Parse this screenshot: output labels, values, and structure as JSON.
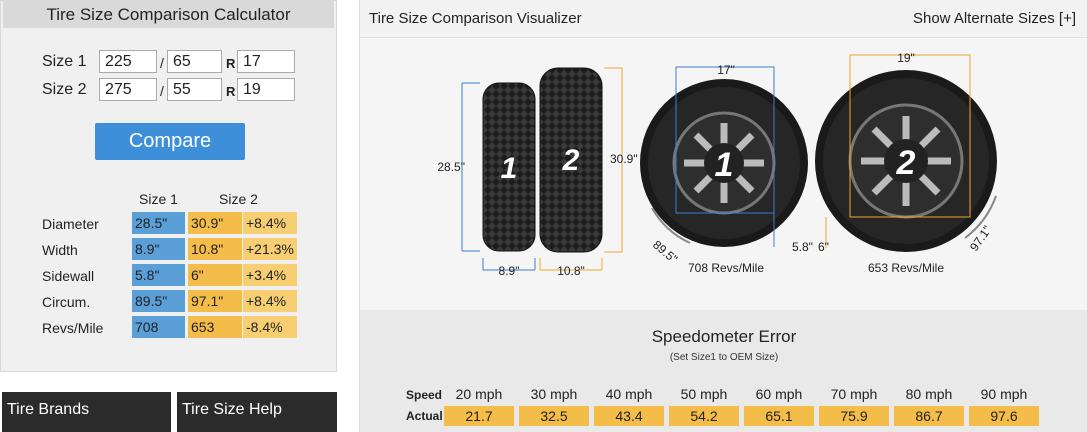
{
  "calculator": {
    "title": "Tire Size Comparison Calculator",
    "size1": {
      "label": "Size 1",
      "width": "225",
      "aspect": "65",
      "rim_prefix": "R",
      "rim": "17"
    },
    "size2": {
      "label": "Size 2",
      "width": "275",
      "aspect": "55",
      "rim_prefix": "R",
      "rim": "19"
    },
    "slash": "/",
    "compare_label": "Compare",
    "col_size1": "Size 1",
    "col_size2": "Size 2",
    "rows": [
      {
        "label": "Diameter",
        "s1": "28.5\"",
        "s2": "30.9\"",
        "diff": "+8.4%"
      },
      {
        "label": "Width",
        "s1": "8.9\"",
        "s2": "10.8\"",
        "diff": "+21.3%"
      },
      {
        "label": "Sidewall",
        "s1": "5.8\"",
        "s2": "6\"",
        "diff": "+3.4%"
      },
      {
        "label": "Circum.",
        "s1": "89.5\"",
        "s2": "97.1\"",
        "diff": "+8.4%"
      },
      {
        "label": "Revs/Mile",
        "s1": "708",
        "s2": "653",
        "diff": "-8.4%"
      }
    ]
  },
  "nav": {
    "tire_brands": "Tire Brands",
    "tire_size_help": "Tire Size Help"
  },
  "visualizer": {
    "title": "Tire Size Comparison Visualizer",
    "alt_sizes": "Show Alternate Sizes [+]",
    "front": {
      "tire1_number": "1",
      "tire2_number": "2",
      "tire1_height": "28.5\"",
      "tire2_height": "30.9\"",
      "tire1_width": "8.9\"",
      "tire2_width": "10.8\""
    },
    "side1": {
      "number": "1",
      "rim": "17\"",
      "sidewall": "5.8\"",
      "circum": "89.5\"",
      "revs": "708 Revs/Mile"
    },
    "side2": {
      "number": "2",
      "rim": "19\"",
      "sidewall": "6\"",
      "circum": "97.1\"",
      "revs": "653 Revs/Mile"
    }
  },
  "speedometer": {
    "title": "Speedometer Error",
    "subtitle": "(Set Size1 to OEM Size)",
    "speed_label": "Speed",
    "actual_label": "Actual",
    "speeds": [
      "20 mph",
      "30 mph",
      "40 mph",
      "50 mph",
      "60 mph",
      "70 mph",
      "80 mph",
      "90 mph"
    ],
    "actual": [
      "21.7",
      "32.5",
      "43.4",
      "54.2",
      "65.1",
      "75.9",
      "86.7",
      "97.6"
    ]
  },
  "colors": {
    "size1": "#5b9fd8",
    "size2": "#f4bd49",
    "diff": "#f7cf72",
    "compare_button": "#3d8fd9",
    "nav": "#2b2b2b"
  }
}
